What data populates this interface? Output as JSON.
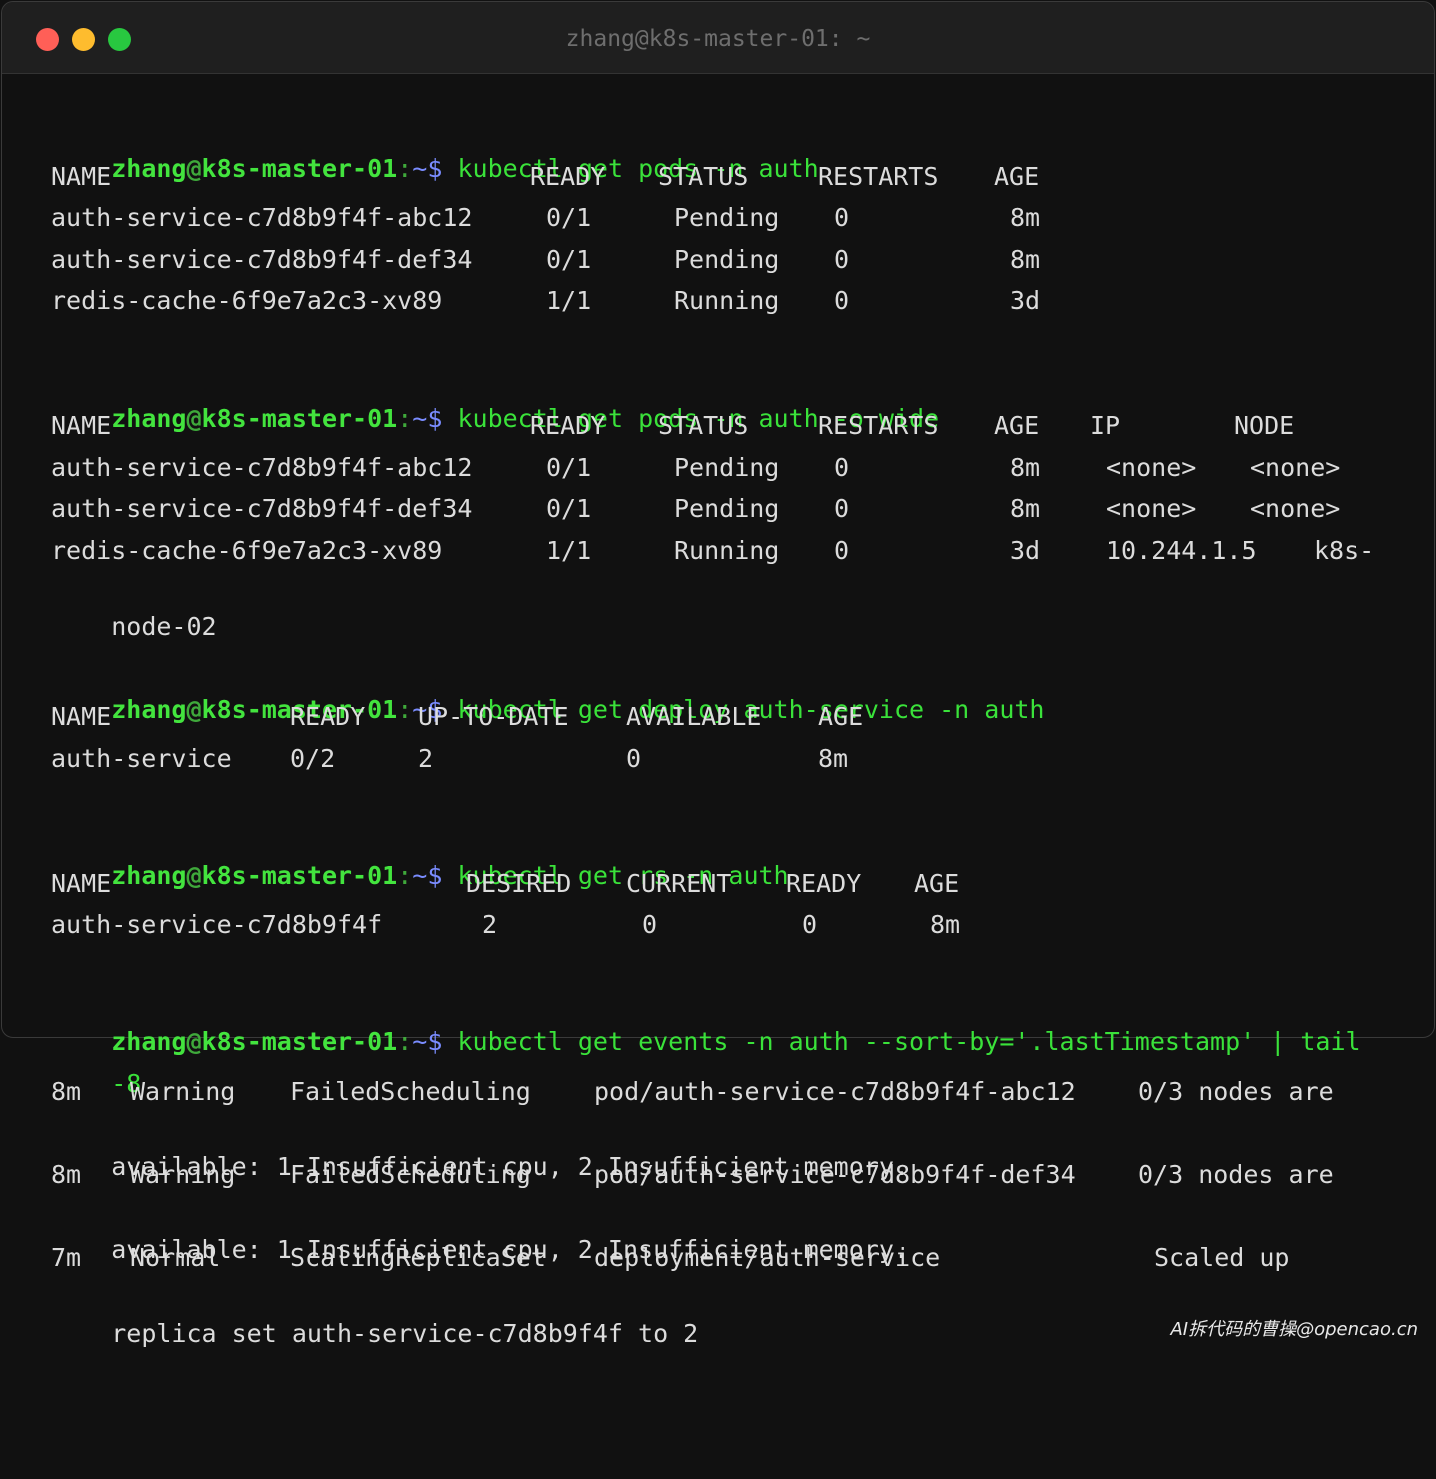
{
  "window": {
    "title": "zhang@k8s-master-01: ~",
    "buttons": [
      "close",
      "minimize",
      "maximize"
    ]
  },
  "prompt": {
    "user": "zhang",
    "at": "@",
    "host": "k8s-master-01",
    "colon": ":",
    "path": "~",
    "dollar": "$"
  },
  "commands": [
    "kubectl get pods -n auth",
    "kubectl get pods -n auth -o wide",
    "kubectl get deploy auth-service -n auth",
    "kubectl get rs -n auth",
    "kubectl get events -n auth --sort-by='.lastTimestamp' | tail",
    "-8"
  ],
  "pods": {
    "headers": [
      "NAME",
      "READY",
      "STATUS",
      "RESTARTS",
      "AGE"
    ],
    "rows": [
      [
        "auth-service-c7d8b9f4f-abc12",
        "0/1",
        "Pending",
        "0",
        "8m"
      ],
      [
        "auth-service-c7d8b9f4f-def34",
        "0/1",
        "Pending",
        "0",
        "8m"
      ],
      [
        "redis-cache-6f9e7a2c3-xv89",
        "1/1",
        "Running",
        "0",
        "3d"
      ]
    ]
  },
  "pods_wide": {
    "headers": [
      "NAME",
      "READY",
      "STATUS",
      "RESTARTS",
      "AGE",
      "IP",
      "NODE"
    ],
    "rows": [
      [
        "auth-service-c7d8b9f4f-abc12",
        "0/1",
        "Pending",
        "0",
        "8m",
        "<none>",
        "<none>"
      ],
      [
        "auth-service-c7d8b9f4f-def34",
        "0/1",
        "Pending",
        "0",
        "8m",
        "<none>",
        "<none>"
      ],
      [
        "redis-cache-6f9e7a2c3-xv89",
        "1/1",
        "Running",
        "0",
        "3d",
        "10.244.1.5",
        "k8s-"
      ]
    ],
    "wrap": "node-02"
  },
  "deploy": {
    "headers": [
      "NAME",
      "READY",
      "UP-TO-DATE",
      "AVAILABLE",
      "AGE"
    ],
    "rows": [
      [
        "auth-service",
        "0/2",
        "2",
        "0",
        "8m"
      ]
    ]
  },
  "rs": {
    "headers": [
      "NAME",
      "DESIRED",
      "CURRENT",
      "READY",
      "AGE"
    ],
    "rows": [
      [
        "auth-service-c7d8b9f4f",
        "2",
        "0",
        "0",
        "8m"
      ]
    ]
  },
  "events": {
    "rows": [
      [
        "8m",
        "Warning",
        "FailedScheduling",
        "pod/auth-service-c7d8b9f4f-abc12",
        "0/3 nodes are"
      ],
      [
        "8m",
        "Warning",
        "FailedScheduling",
        "pod/auth-service-c7d8b9f4f-def34",
        "0/3 nodes are"
      ],
      [
        "7m",
        "Normal",
        "ScalingReplicaSet",
        "deployment/auth-service",
        "Scaled up"
      ]
    ],
    "wraps": [
      "available: 1 Insufficient cpu, 2 Insufficient memory.",
      "available: 1 Insufficient cpu, 2 Insufficient memory.",
      "replica set auth-service-c7d8b9f4f to 2"
    ]
  },
  "watermark": "AI拆代码的曹操@opencao.cn"
}
